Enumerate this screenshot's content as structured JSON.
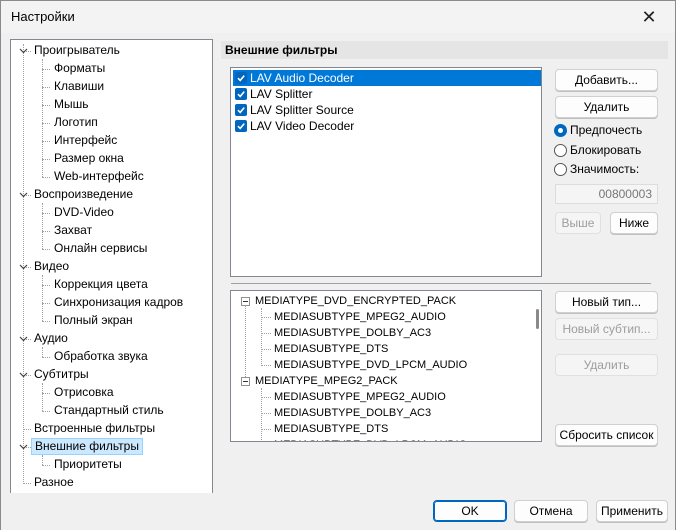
{
  "window": {
    "title": "Настройки",
    "close_glyph": "✕"
  },
  "tree": {
    "groups": [
      {
        "label": "Проигрыватель",
        "children": [
          "Форматы",
          "Клавиши",
          "Мышь",
          "Логотип",
          "Интерфейс",
          "Размер окна",
          "Web-интерфейс"
        ]
      },
      {
        "label": "Воспроизведение",
        "children": [
          "DVD-Video",
          "Захват",
          "Онлайн сервисы"
        ]
      },
      {
        "label": "Видео",
        "children": [
          "Коррекция цвета",
          "Синхронизация кадров",
          "Полный экран"
        ]
      },
      {
        "label": "Аудио",
        "children": [
          "Обработка звука"
        ]
      },
      {
        "label": "Субтитры",
        "children": [
          "Отрисовка",
          "Стандартный стиль"
        ]
      },
      {
        "label": "Встроенные фильтры",
        "children": []
      },
      {
        "label": "Внешние фильтры",
        "children": [
          "Приоритеты"
        ],
        "selected": true
      },
      {
        "label": "Разное",
        "children": []
      }
    ]
  },
  "panel": {
    "header": "Внешние фильтры",
    "filters": [
      {
        "label": "LAV Audio Decoder",
        "checked": true,
        "selected": true
      },
      {
        "label": "LAV Splitter",
        "checked": true
      },
      {
        "label": "LAV Splitter Source",
        "checked": true
      },
      {
        "label": "LAV Video Decoder",
        "checked": true
      }
    ],
    "buttons": {
      "add": "Добавить...",
      "remove": "Удалить",
      "up": "Выше",
      "down": "Ниже",
      "new_type": "Новый тип...",
      "new_subtype": "Новый субтип...",
      "remove_type": "Удалить",
      "reset_list": "Сбросить список"
    },
    "merit": {
      "options": [
        "Предпочесть",
        "Блокировать",
        "Значимость:"
      ],
      "selected_index": 0,
      "value": "00800003"
    },
    "media_types": [
      {
        "label": "MEDIATYPE_DVD_ENCRYPTED_PACK",
        "subtypes": [
          "MEDIASUBTYPE_MPEG2_AUDIO",
          "MEDIASUBTYPE_DOLBY_AC3",
          "MEDIASUBTYPE_DTS",
          "MEDIASUBTYPE_DVD_LPCM_AUDIO"
        ]
      },
      {
        "label": "MEDIATYPE_MPEG2_PACK",
        "subtypes": [
          "MEDIASUBTYPE_MPEG2_AUDIO",
          "MEDIASUBTYPE_DOLBY_AC3",
          "MEDIASUBTYPE_DTS",
          "MEDIASUBTYPE_DVD_LPCM_AUDIO"
        ]
      }
    ]
  },
  "footer": {
    "ok": "OK",
    "cancel": "Отмена",
    "apply": "Применить"
  },
  "colors": {
    "accent": "#0067c0",
    "selection": "#0078d7",
    "tree_selection": "#cce8ff"
  }
}
